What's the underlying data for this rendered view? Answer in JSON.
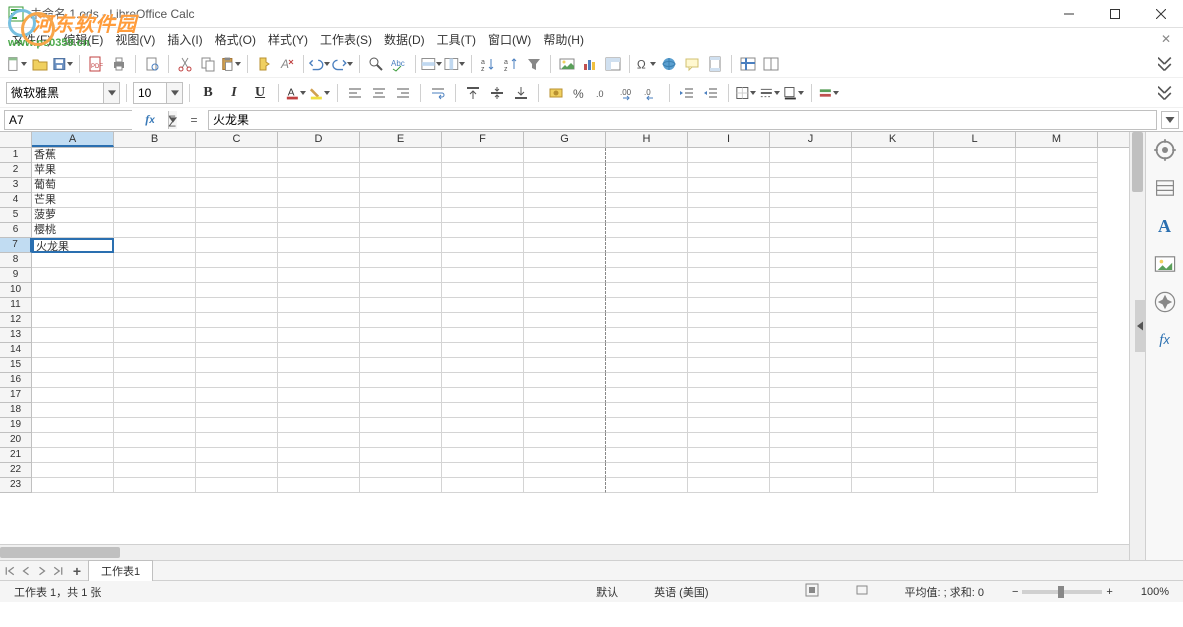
{
  "window": {
    "title": "未命名 1.ods - LibreOffice Calc"
  },
  "watermark": {
    "line1": "河东软件园",
    "line2": "www.pc0359.cn"
  },
  "menu": {
    "items": [
      "文件(F)",
      "编辑(E)",
      "视图(V)",
      "插入(I)",
      "格式(O)",
      "样式(Y)",
      "工作表(S)",
      "数据(D)",
      "工具(T)",
      "窗口(W)",
      "帮助(H)"
    ]
  },
  "format": {
    "font_name": "微软雅黑",
    "font_size": "10"
  },
  "formula": {
    "cell_ref": "A7",
    "formula_text": "火龙果"
  },
  "columns": [
    "A",
    "B",
    "C",
    "D",
    "E",
    "F",
    "G",
    "H",
    "I",
    "J",
    "K",
    "L",
    "M"
  ],
  "active": {
    "row": 7,
    "col": "A"
  },
  "cells": {
    "A": [
      "香蕉",
      "苹果",
      "葡萄",
      "芒果",
      "菠萝",
      "樱桃",
      "火龙果"
    ]
  },
  "row_count": 23,
  "sheet": {
    "tab_name": "工作表1"
  },
  "status": {
    "sheet_info": "工作表 1，共 1 张",
    "mode": "默认",
    "language": "英语 (美国)",
    "calc": "平均值: ; 求和: 0",
    "zoom": "100%"
  }
}
